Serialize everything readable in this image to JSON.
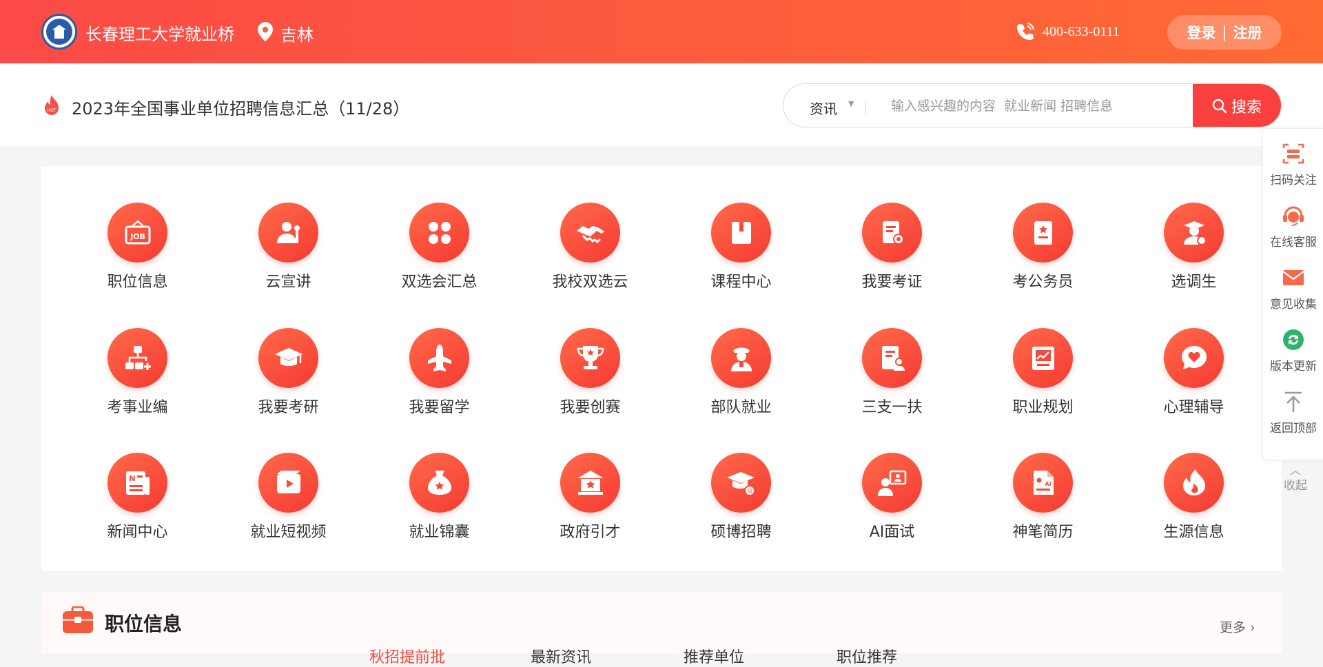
{
  "header": {
    "site_name": "长春理工大学就业桥",
    "location": "吉林",
    "phone": "400-633-0111",
    "login_label": "登录",
    "separator": "|",
    "register_label": "注册"
  },
  "notice": {
    "text": "2023年全国事业单位招聘信息汇总（11/28）"
  },
  "search": {
    "category": "资讯",
    "placeholder": "输入感兴趣的内容  就业新闻 招聘信息",
    "button_label": "搜索"
  },
  "grid": {
    "items": [
      {
        "label": "职位信息",
        "icon": "job-sign-icon"
      },
      {
        "label": "云宣讲",
        "icon": "speaker-icon"
      },
      {
        "label": "双选会汇总",
        "icon": "clover-icon"
      },
      {
        "label": "我校双选云",
        "icon": "handshake-icon"
      },
      {
        "label": "课程中心",
        "icon": "book-icon"
      },
      {
        "label": "我要考证",
        "icon": "certificate-icon"
      },
      {
        "label": "考公务员",
        "icon": "document-star-icon"
      },
      {
        "label": "选调生",
        "icon": "graduate-person-icon"
      },
      {
        "label": "考事业编",
        "icon": "org-chart-icon"
      },
      {
        "label": "我要考研",
        "icon": "graduation-cap-icon"
      },
      {
        "label": "我要留学",
        "icon": "airplane-icon"
      },
      {
        "label": "我要创赛",
        "icon": "trophy-icon"
      },
      {
        "label": "部队就业",
        "icon": "soldier-icon"
      },
      {
        "label": "三支一扶",
        "icon": "resume-person-icon"
      },
      {
        "label": "职业规划",
        "icon": "chart-board-icon"
      },
      {
        "label": "心理辅导",
        "icon": "heart-chat-icon"
      },
      {
        "label": "新闻中心",
        "icon": "newspaper-icon"
      },
      {
        "label": "就业短视频",
        "icon": "video-icon"
      },
      {
        "label": "就业锦囊",
        "icon": "money-bag-icon"
      },
      {
        "label": "政府引才",
        "icon": "government-building-icon"
      },
      {
        "label": "硕博招聘",
        "icon": "doctoral-cap-icon"
      },
      {
        "label": "AI面试",
        "icon": "ai-interview-icon"
      },
      {
        "label": "神笔简历",
        "icon": "ai-resume-icon"
      },
      {
        "label": "生源信息",
        "icon": "flame-icon"
      }
    ]
  },
  "float_panel": {
    "items": [
      {
        "label": "扫码关注",
        "icon": "scan-icon",
        "color": "#f56a4a"
      },
      {
        "label": "在线客服",
        "icon": "customer-service-icon",
        "color": "#f56a4a"
      },
      {
        "label": "意见收集",
        "icon": "mail-icon",
        "color": "#f56a4a"
      },
      {
        "label": "版本更新",
        "icon": "refresh-icon",
        "color": "#2fb36a"
      },
      {
        "label": "返回顶部",
        "icon": "back-to-top-icon",
        "color": "#999999"
      }
    ],
    "collapse_label": "收起"
  },
  "job_section": {
    "title": "职位信息",
    "more_label": "更多",
    "tabs": [
      "秋招提前批",
      "最新资讯",
      "推荐单位",
      "职位推荐"
    ]
  },
  "theme": {
    "accent": "#fa3f3f",
    "header_gradient_start": "#fb4a47",
    "header_gradient_end": "#ff6a33"
  }
}
